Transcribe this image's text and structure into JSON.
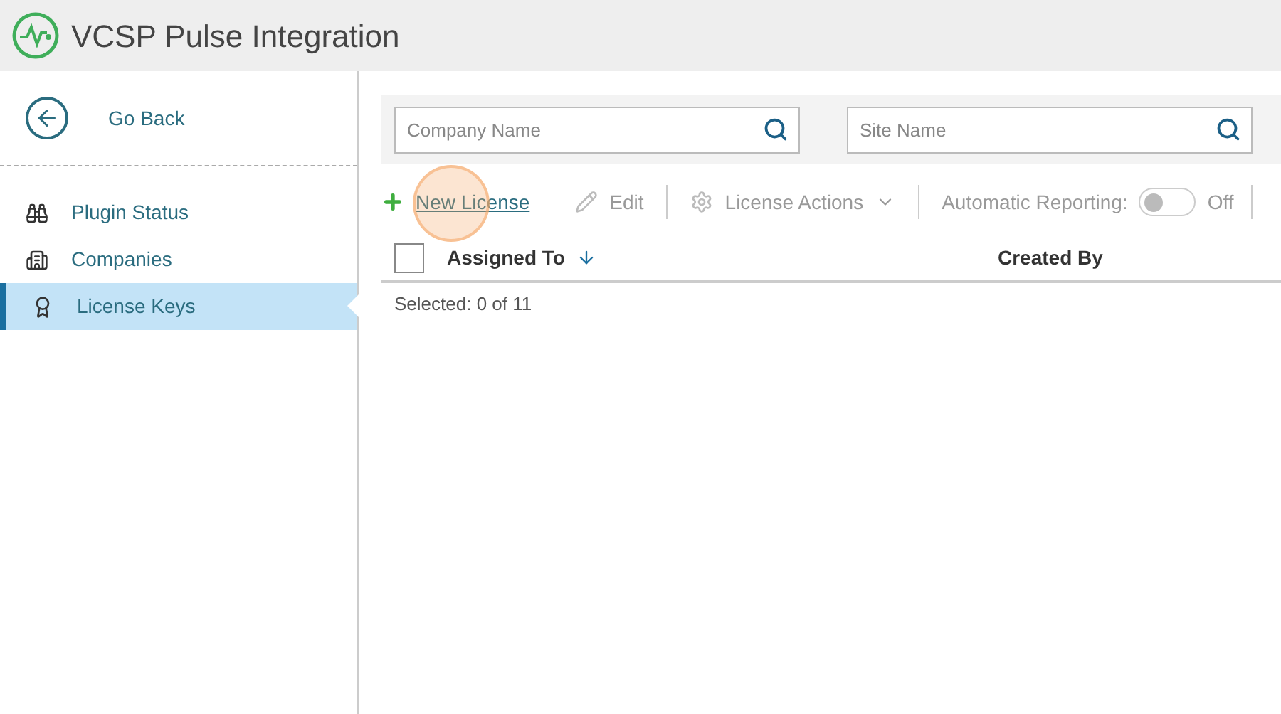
{
  "header": {
    "title": "VCSP Pulse Integration"
  },
  "sidebar": {
    "back": "Go Back",
    "items": [
      {
        "label": "Plugin Status",
        "kind": "binoculars",
        "selected": false
      },
      {
        "label": "Companies",
        "kind": "buildings",
        "selected": false
      },
      {
        "label": "License Keys",
        "kind": "award",
        "selected": true
      }
    ]
  },
  "filters": [
    {
      "placeholder": "Company Name"
    },
    {
      "placeholder": "Site Name"
    }
  ],
  "toolbar": {
    "new": "New License",
    "edit": "Edit",
    "actions": "License Actions",
    "reporting_label": "Automatic Reporting:",
    "reporting_on": false,
    "reporting_state": "Off"
  },
  "table": {
    "checked": false,
    "columns": [
      {
        "label": "Assigned To",
        "sorted": true
      },
      {
        "label": "Created By",
        "sorted": false
      }
    ],
    "selected": "Selected: 0 of 11"
  }
}
